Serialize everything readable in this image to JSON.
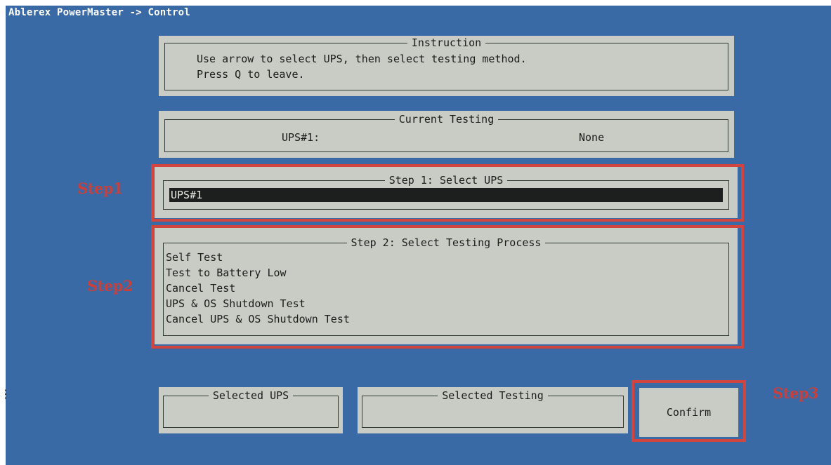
{
  "window": {
    "title": "Ablerex PowerMaster -> Control"
  },
  "instruction": {
    "title": "Instruction",
    "lines": [
      "Use arrow to select UPS, then select testing method.",
      "Press Q to leave."
    ]
  },
  "current_testing": {
    "title": "Current Testing",
    "ups_label": "UPS#1:",
    "status": "None"
  },
  "step1": {
    "title": "Step 1: Select UPS",
    "items": [
      "UPS#1"
    ],
    "annotation": "Step1"
  },
  "step2": {
    "title": "Step 2: Select Testing Process",
    "items": [
      "Self Test",
      "Test to Battery Low",
      "Cancel Test",
      "UPS & OS Shutdown Test",
      "Cancel UPS & OS Shutdown Test"
    ],
    "annotation": "Step2"
  },
  "selected_ups": {
    "title": "Selected UPS",
    "value": ""
  },
  "selected_testing": {
    "title": "Selected Testing",
    "value": ""
  },
  "confirm": {
    "label": "Confirm",
    "annotation": "Step3"
  },
  "colors": {
    "background": "#3a6aa6",
    "panel": "#c8ccc4",
    "highlight_row": "#1c1f1e",
    "annotation_red": "#d0453f"
  }
}
